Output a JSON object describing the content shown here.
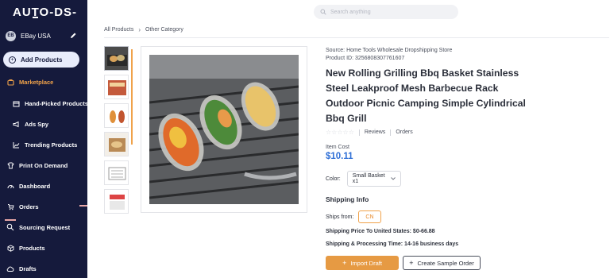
{
  "app": {
    "logo": "AUTO-DS-"
  },
  "sidebar": {
    "store_initials": "EB",
    "store_name": "EBay USA",
    "add_products": "Add Products",
    "items": [
      {
        "label": "Marketplace",
        "icon": "bag-icon",
        "active": true
      },
      {
        "label": "Hand-Picked Products",
        "icon": "box-icon"
      },
      {
        "label": "Ads Spy",
        "icon": "megaphone-icon"
      },
      {
        "label": "Trending Products",
        "icon": "trend-chart-icon"
      },
      {
        "label": "Print On Demand",
        "icon": "shirt-icon"
      },
      {
        "label": "Dashboard",
        "icon": "gauge-icon"
      },
      {
        "label": "Orders",
        "icon": "cart-icon"
      },
      {
        "label": "Sourcing Request",
        "icon": "search-doc-icon"
      },
      {
        "label": "Products",
        "icon": "cube-icon"
      },
      {
        "label": "Drafts",
        "icon": "cloud-icon"
      }
    ]
  },
  "search": {
    "placeholder": "Search anything"
  },
  "breadcrumb": {
    "root": "All Products",
    "current": "Other Category"
  },
  "product": {
    "source": "Source: Home Tools Wholesale Dropshipping Store",
    "product_id": "Product ID: 3256808307761607",
    "title": "New Rolling Grilling Bbq Basket Stainless Steel Leakproof Mesh Barbecue Rack Outdoor Picnic Camping Simple Cylindrical Bbq Grill",
    "reviews_label": "Reviews",
    "orders_label": "Orders",
    "rating_stars": 0,
    "item_cost_label": "Item Cost",
    "item_cost": "$10.11",
    "color_label": "Color:",
    "color_value": "Small Basket x1",
    "thumbnail_count": 6
  },
  "shipping": {
    "heading": "Shipping Info",
    "ships_from_label": "Ships from:",
    "ships_from_value": "CN",
    "price_text": "Shipping Price To United States: $0-66.88",
    "time_text": "Shipping & Processing Time: 14-16 business days"
  },
  "actions": {
    "import_draft": "Import Draft",
    "create_sample": "Create Sample Order"
  },
  "colors": {
    "sidebar_bg": "#151a3c",
    "accent_orange": "#e69a43",
    "price_blue": "#2f6fd6"
  }
}
